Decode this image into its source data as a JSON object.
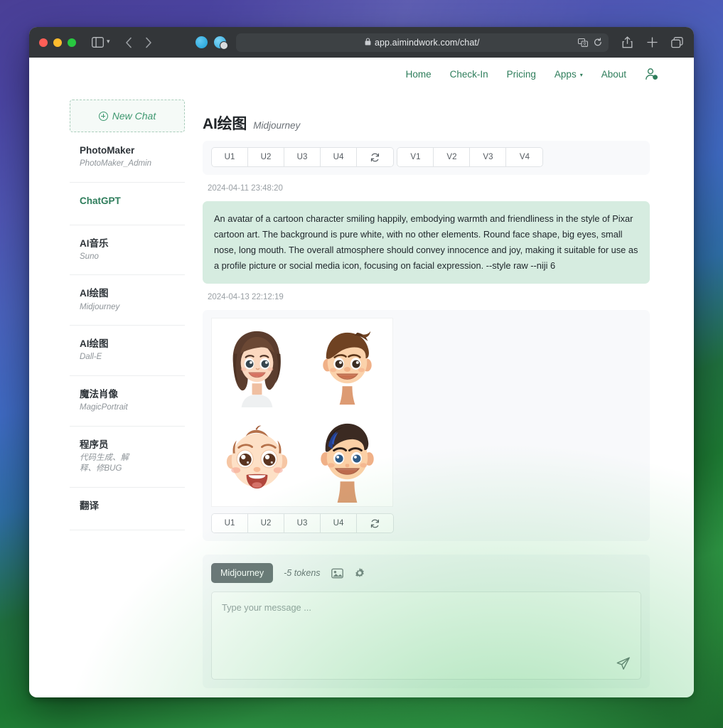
{
  "browser": {
    "url": "app.aimindwork.com/chat/",
    "lock_icon": "lock-icon",
    "back_icon": "back-arrow-icon",
    "forward_icon": "forward-arrow-icon",
    "sidebar_icon": "sidebar-toggle-icon",
    "reload_icon": "reload-icon",
    "translate_icon": "translate-icon",
    "share_icon": "share-icon",
    "newtab_icon": "plus-icon",
    "tabs_icon": "tab-overview-icon"
  },
  "topnav": {
    "items": [
      {
        "label": "Home"
      },
      {
        "label": "Check-In"
      },
      {
        "label": "Pricing"
      },
      {
        "label": "Apps",
        "caret": "▾"
      },
      {
        "label": "About"
      }
    ],
    "account_icon": "user-account-icon"
  },
  "sidebar": {
    "new_chat_label": "New Chat",
    "items": [
      {
        "title": "PhotoMaker",
        "sub": "PhotoMaker_Admin",
        "active": false
      },
      {
        "title": "ChatGPT",
        "sub": "",
        "active": true
      },
      {
        "title": "AI音乐",
        "sub": "Suno",
        "active": false
      },
      {
        "title": "AI绘图",
        "sub": "Midjourney",
        "active": false
      },
      {
        "title": "AI绘图",
        "sub": "Dall-E",
        "active": false
      },
      {
        "title": "魔法肖像",
        "sub": "MagicPortrait",
        "active": false
      },
      {
        "title": "程序员",
        "sub": "代码生成、解释、修BUG",
        "active": false
      },
      {
        "title": "翻译",
        "sub": "",
        "active": false
      }
    ]
  },
  "main": {
    "title": "AI绘图",
    "subtitle": "Midjourney",
    "upscale_buttons": [
      "U1",
      "U2",
      "U3",
      "U4"
    ],
    "variation_buttons": [
      "V1",
      "V2",
      "V3",
      "V4"
    ],
    "refresh_icon": "refresh-icon",
    "messages": [
      {
        "timestamp": "2024-04-11 23:48:20",
        "text": "An avatar of a cartoon character smiling happily, embodying warmth and friendliness in the style of Pixar cartoon art. The background is pure white, with no other elements. Round face shape, big eyes, small nose, long mouth. The overall atmosphere should convey innocence and joy, making it suitable for use as a profile picture or social media icon, focusing on facial expression. --style raw --niji 6"
      },
      {
        "timestamp": "2024-04-13 22:12:19",
        "image_grid": [
          "girl-brown-bob-hair-avatar",
          "boy-brown-swept-hair-avatar",
          "baby-wide-eyes-avatar",
          "young-man-dark-hair-avatar"
        ]
      }
    ]
  },
  "composer": {
    "model_chip": "Midjourney",
    "tokens": "-5 tokens",
    "image_icon": "image-attach-icon",
    "settings_icon": "gear-icon",
    "placeholder": "Type your message ...",
    "value": "",
    "send_icon": "send-paper-plane-icon"
  },
  "colors": {
    "brand_green": "#2e7d5b",
    "bubble_green": "#d6ece0",
    "chip_gray": "#6d7479",
    "panel_gray": "#f8f9fb"
  }
}
